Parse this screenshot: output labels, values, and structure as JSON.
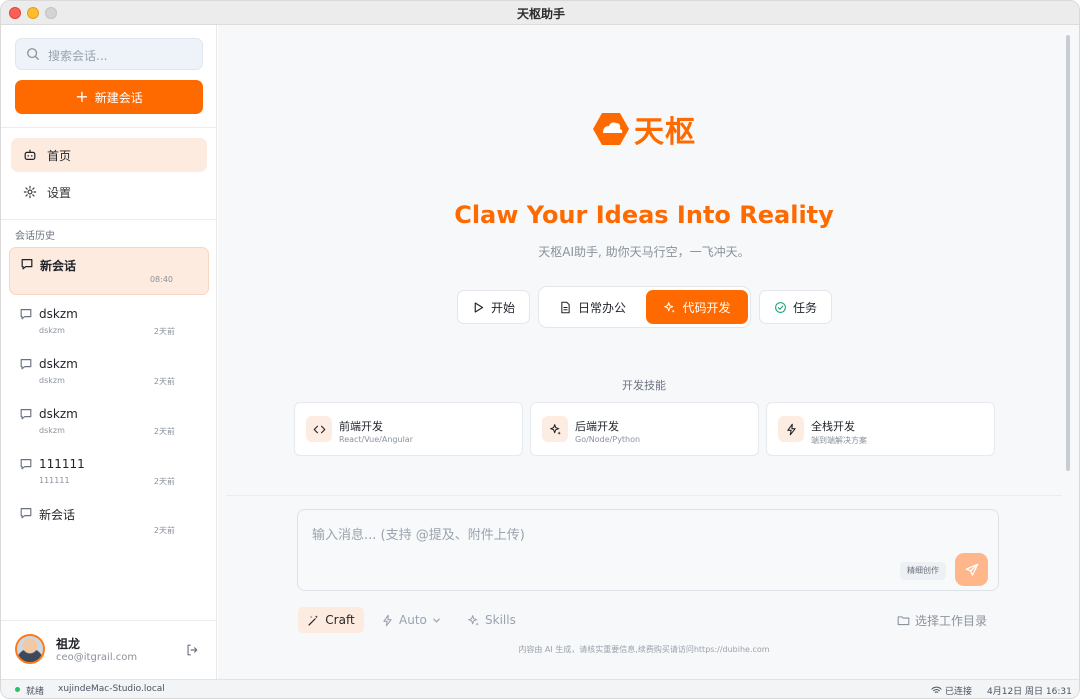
{
  "window": {
    "title": "天枢助手"
  },
  "sidebar": {
    "search_placeholder": "搜索会话...",
    "new_chat_label": "新建会话",
    "nav": [
      {
        "label": "首页",
        "icon": "robot-icon",
        "active": true
      },
      {
        "label": "设置",
        "icon": "gear-icon",
        "active": false
      }
    ],
    "history_label": "会话历史",
    "conversations": [
      {
        "title": "新会话",
        "subtitle": "",
        "time": "08:40",
        "active": true
      },
      {
        "title": "dskzm",
        "subtitle": "dskzm",
        "time": "2天前",
        "active": false
      },
      {
        "title": "dskzm",
        "subtitle": "dskzm",
        "time": "2天前",
        "active": false
      },
      {
        "title": "dskzm",
        "subtitle": "dskzm",
        "time": "2天前",
        "active": false
      },
      {
        "title": "111111",
        "subtitle": "111111",
        "time": "2天前",
        "active": false
      },
      {
        "title": "新会话",
        "subtitle": "",
        "time": "2天前",
        "active": false
      }
    ],
    "user": {
      "name": "祖龙",
      "email": "ceo@itgrail.com"
    }
  },
  "main": {
    "logo_text": "天枢",
    "hero_title": "Claw Your Ideas Into Reality",
    "hero_subtitle": "天枢AI助手, 助你天马行空，一飞冲天。",
    "modes": [
      {
        "label": "开始",
        "icon": "play-icon",
        "active": false
      },
      {
        "label": "日常办公",
        "icon": "document-icon",
        "active": false
      },
      {
        "label": "代码开发",
        "icon": "sparkle-icon",
        "active": true
      },
      {
        "label": "任务",
        "icon": "check-circle-icon",
        "active": false
      }
    ],
    "skills_label": "开发技能",
    "skills": [
      {
        "name": "前端开发",
        "desc": "React/Vue/Angular",
        "icon": "code-icon"
      },
      {
        "name": "后端开发",
        "desc": "Go/Node/Python",
        "icon": "sparkle-icon"
      },
      {
        "name": "全栈开发",
        "desc": "端到端解决方案",
        "icon": "lightning-icon"
      }
    ],
    "input": {
      "placeholder": "输入消息... (支持 @提及、附件上传)",
      "refine_label": "精细创作"
    },
    "tools": {
      "craft": "Craft",
      "auto": "Auto",
      "skills": "Skills",
      "workdir": "选择工作目录"
    },
    "footer_note": "内容由 AI 生成，请核实重要信息,续费购买请访问https://dubihe.com"
  },
  "statusbar": {
    "status": "就绪",
    "host": "xujindeMac-Studio.local",
    "connection": "已连接",
    "datetime": "4月12日 周日 16:31"
  },
  "colors": {
    "accent": "#ff6a00",
    "accent_soft": "#fdebe0",
    "online": "#22c55e"
  }
}
